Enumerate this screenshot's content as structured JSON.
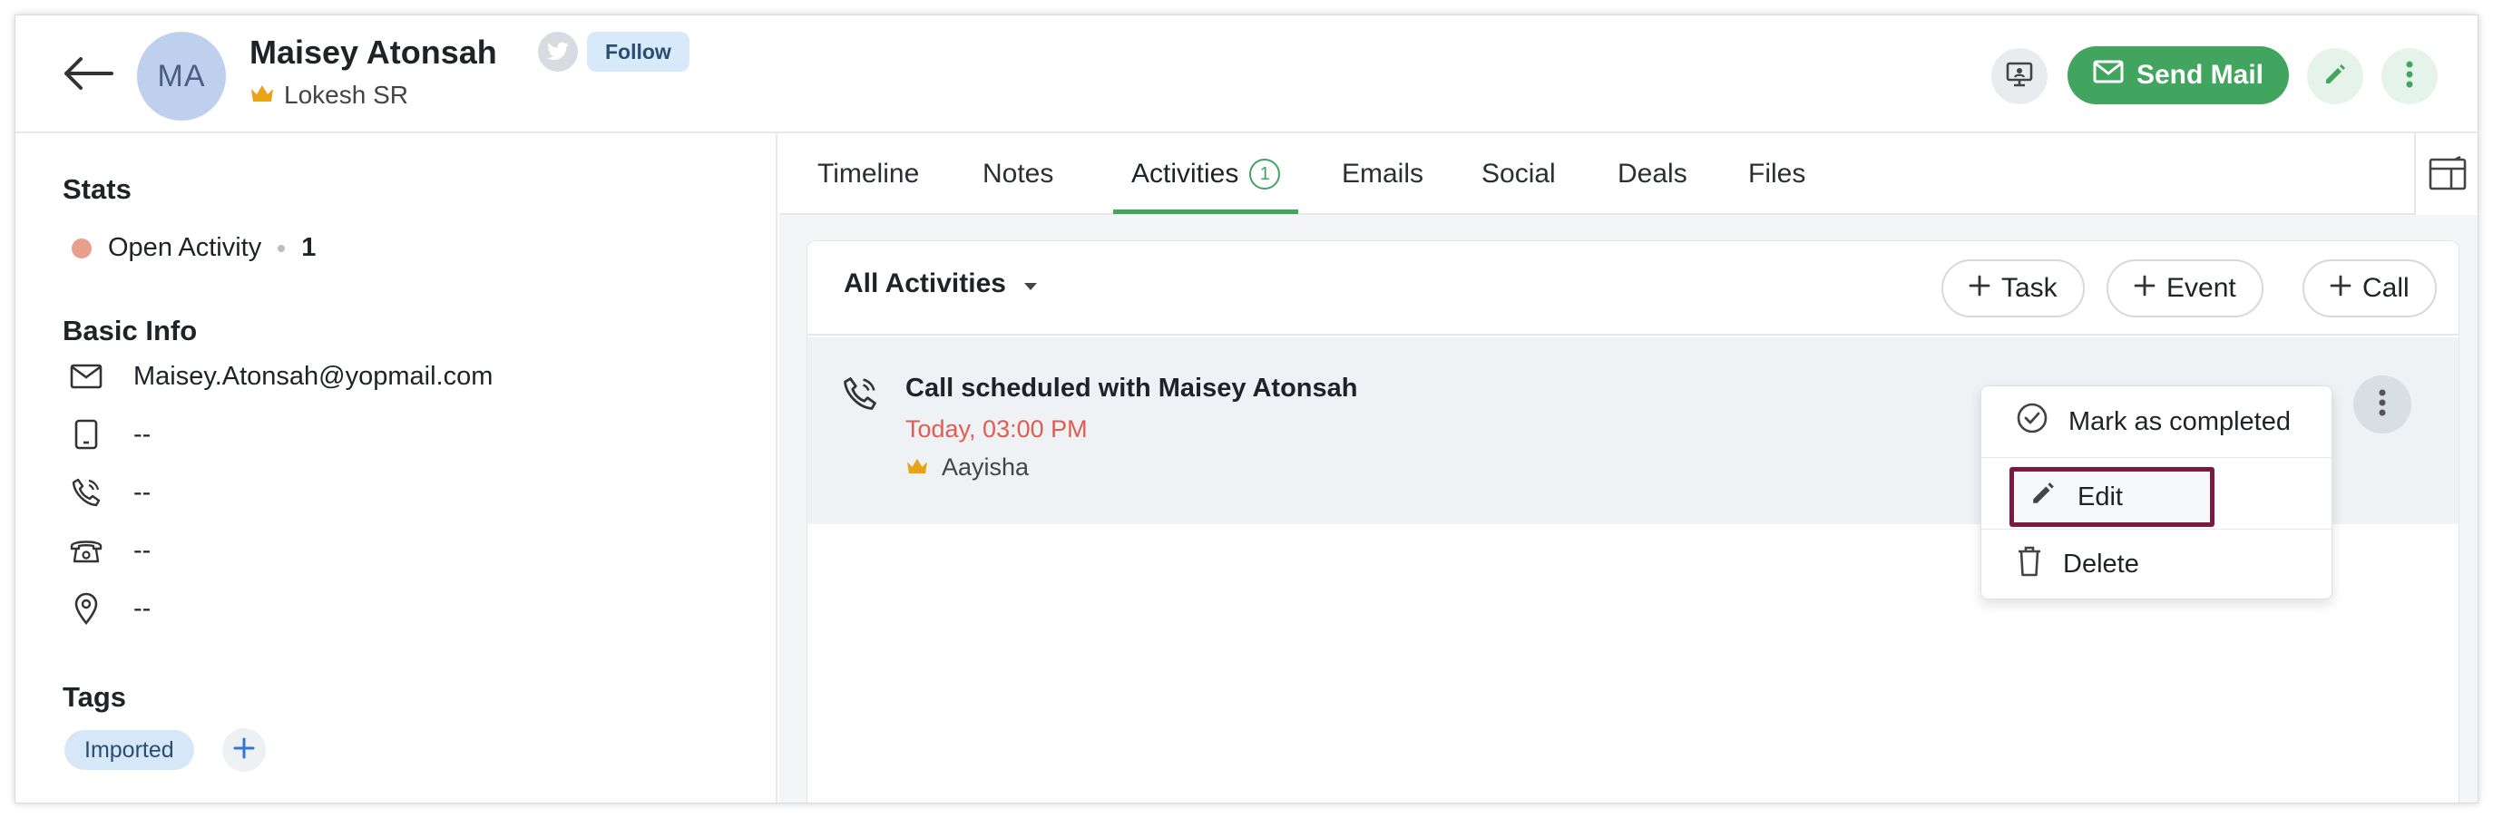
{
  "header": {
    "avatar_initials": "MA",
    "contact_name": "Maisey Atonsah",
    "owner_name": "Lokesh SR",
    "follow_label": "Follow",
    "send_mail_label": "Send Mail"
  },
  "stats": {
    "title": "Stats",
    "open_activity_label": "Open Activity",
    "open_activity_count": "1"
  },
  "basic_info": {
    "title": "Basic Info",
    "email": "Maisey.Atonsah@yopmail.com",
    "mobile": "--",
    "phone": "--",
    "home_phone": "--",
    "address": "--"
  },
  "tags": {
    "title": "Tags",
    "items": [
      "Imported"
    ]
  },
  "tabs": [
    {
      "label": "Timeline"
    },
    {
      "label": "Notes"
    },
    {
      "label": "Activities",
      "badge": "1",
      "active": true
    },
    {
      "label": "Emails"
    },
    {
      "label": "Social"
    },
    {
      "label": "Deals"
    },
    {
      "label": "Files"
    }
  ],
  "activities": {
    "filter_label": "All Activities",
    "add_task_label": "Task",
    "add_event_label": "Event",
    "add_call_label": "Call",
    "items": [
      {
        "title": "Call scheduled with Maisey Atonsah",
        "time": "Today, 03:00 PM",
        "owner": "Aayisha"
      }
    ]
  },
  "context_menu": {
    "mark_completed_label": "Mark as completed",
    "edit_label": "Edit",
    "delete_label": "Delete"
  },
  "colors": {
    "accent_green": "#41a45f",
    "time_red": "#e05c50",
    "highlight_border": "#7a1a40",
    "crown_gold": "#e8a317"
  }
}
